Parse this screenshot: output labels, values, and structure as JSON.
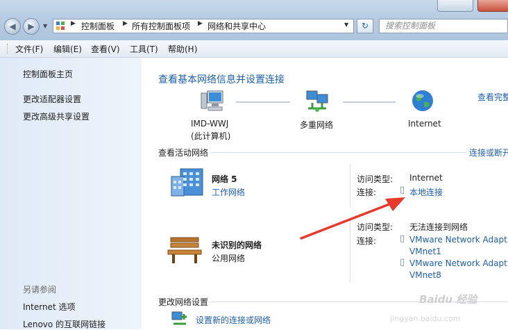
{
  "address": {
    "crumbs": [
      "控制面板",
      "所有控制面板项",
      "网络和共享中心"
    ],
    "search_placeholder": "搜索控制面板"
  },
  "menu": [
    "文件(F)",
    "编辑(E)",
    "查看(V)",
    "工具(T)",
    "帮助(H)"
  ],
  "sidebar": {
    "links": [
      "控制面板主页",
      "更改适配器设置",
      "更改高级共享设置"
    ],
    "see_also_title": "另请参阅",
    "see_also": [
      "Internet 选项",
      "Lenovo 的互联网链接"
    ]
  },
  "main": {
    "title": "查看基本网络信息并设置连接",
    "view_full_map": "查看完整",
    "map": {
      "computer_name": "IMD-WWJ",
      "computer_sub": "(此计算机)",
      "multi": "多重网络",
      "internet": "Internet"
    },
    "active_header": "查看活动网络",
    "connect_disconnect": "连接或断开",
    "networks": [
      {
        "name": "网络  5",
        "type": "工作网络",
        "access_label": "访问类型:",
        "access_value": "Internet",
        "conn_label": "连接:",
        "connections": [
          "本地连接"
        ]
      },
      {
        "name": "未识别的网络",
        "type": "公用网络",
        "access_label": "访问类型:",
        "access_value": "无法连接到网络",
        "conn_label": "连接:",
        "connections": [
          "VMware Network Adapt",
          "VMnet1",
          "VMware Network Adapt",
          "VMnet8"
        ]
      }
    ],
    "change_header": "更改网络设置",
    "setup_link": "设置新的连接或网络"
  },
  "watermark": "Baidu 经验",
  "watermark_sub": "jingyan.baidu.com",
  "colors": {
    "link": "#1f5fb0",
    "header": "#1e5fa8",
    "arrow": "#e8392c"
  }
}
